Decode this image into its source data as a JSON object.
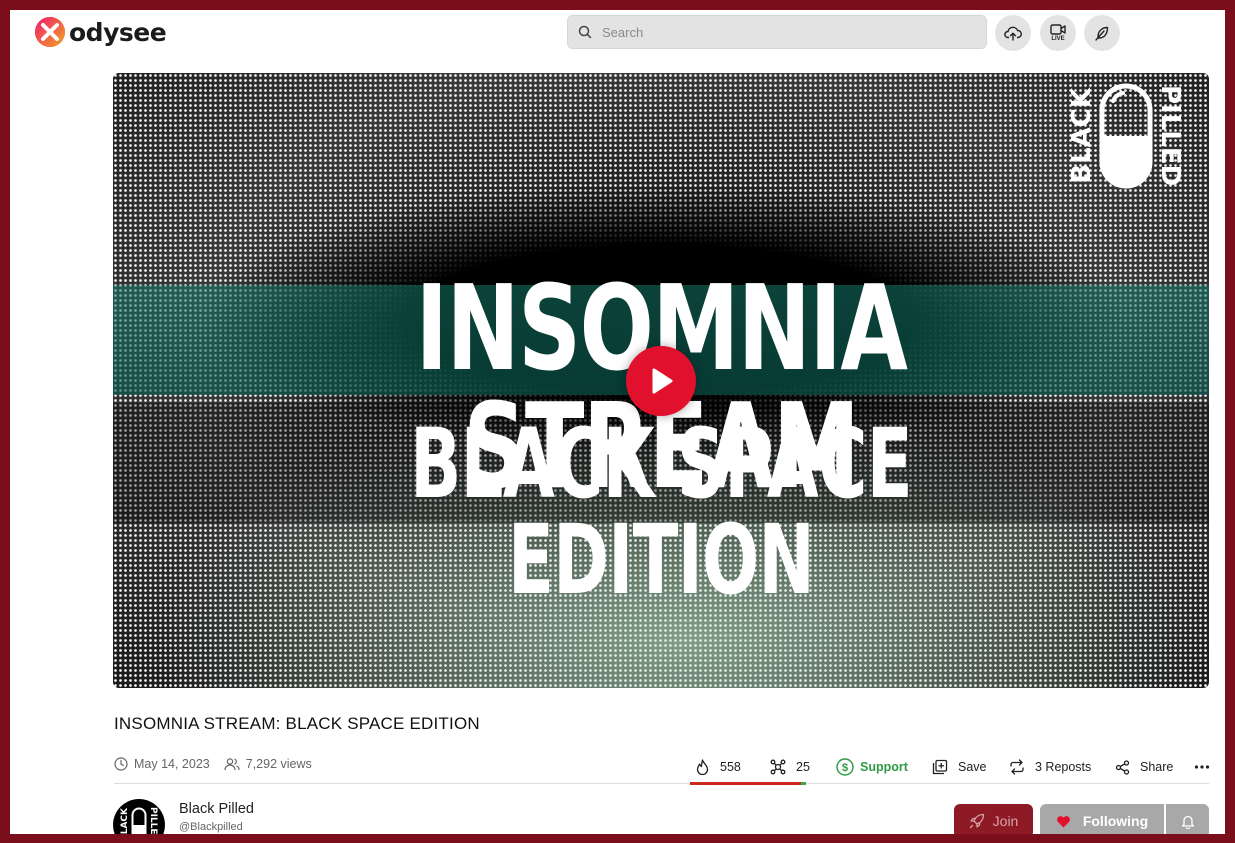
{
  "header": {
    "logo_text": "odysee",
    "search_placeholder": "Search",
    "upload_icon": "cloud-upload-icon",
    "live_label": "LIVE",
    "publish_icon": "feather-icon"
  },
  "video": {
    "thumbnail_line1": "INSOMNIA STREAM",
    "thumbnail_line2": "BLACK SPACE EDITION",
    "channel_logo_left": "BLACK",
    "channel_logo_right": "PILLED",
    "play_icon": "play-icon"
  },
  "details": {
    "title": "INSOMNIA STREAM: BLACK SPACE EDITION",
    "date": "May 14, 2023",
    "views": "7,292 views"
  },
  "actions": {
    "fire_count": "558",
    "slime_count": "25",
    "support_label": "Support",
    "save_label": "Save",
    "reposts_label": "3 Reposts",
    "share_label": "Share",
    "like_ratio": 0.957
  },
  "channel": {
    "name": "Black Pilled",
    "handle": "@Blackpilled",
    "avatar_left": "BLACK",
    "avatar_right": "PILLED",
    "join_label": "Join",
    "following_label": "Following"
  },
  "colors": {
    "frame": "#7a0f1b",
    "play": "#e1112d",
    "support": "#2f9a43",
    "fire_bar": "#cc2a1a",
    "join_bg": "#8e1a25"
  }
}
